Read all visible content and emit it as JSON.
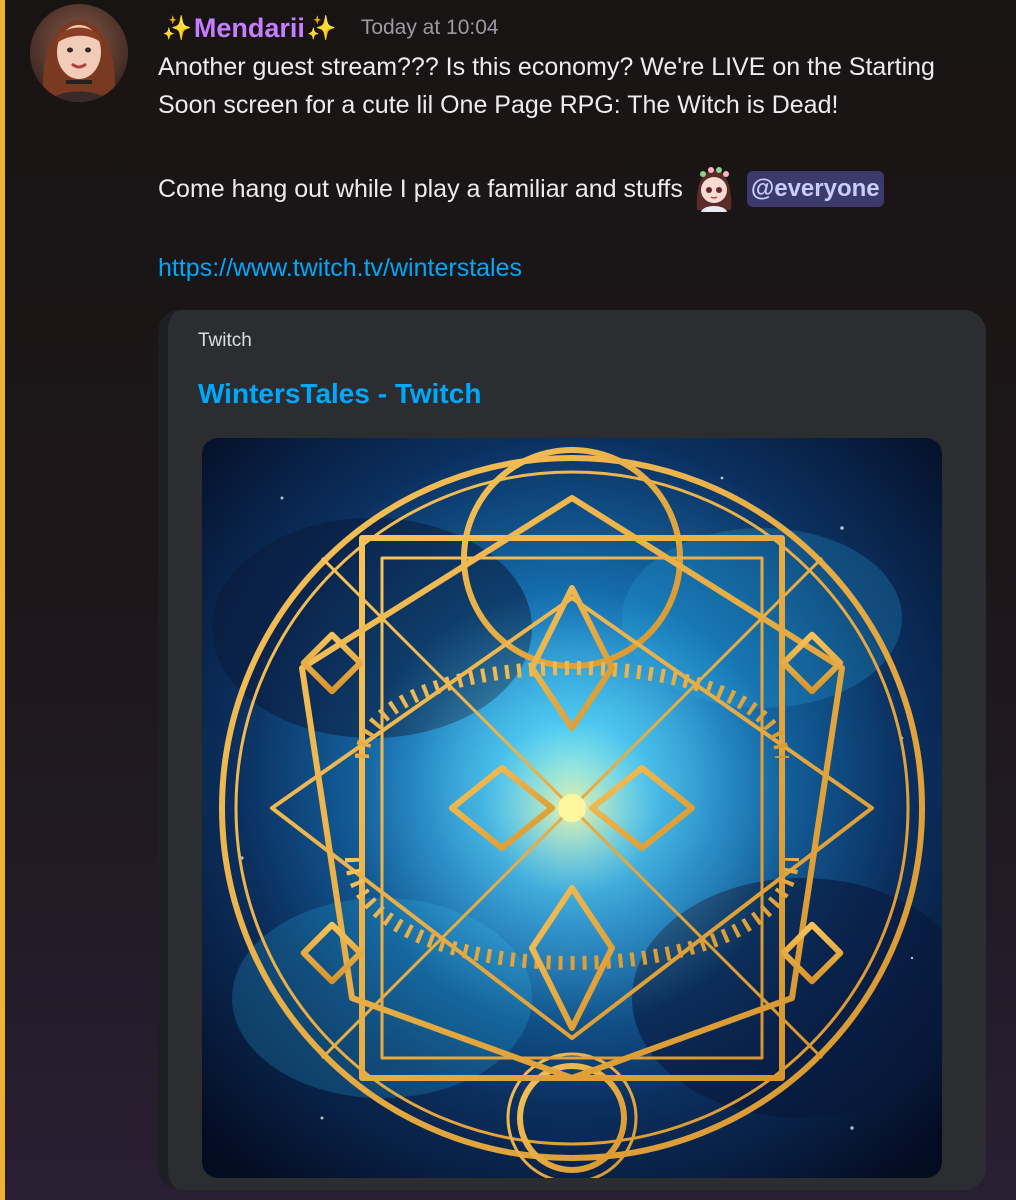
{
  "colors": {
    "mention_bar": "#f0b232",
    "username": "#c77dff",
    "link": "#00a8fc",
    "mention_bg": "#3c3a6b",
    "embed_bg": "#2b2d31"
  },
  "message": {
    "author": {
      "prefix_emoji": "✨",
      "name": "Mendarii",
      "suffix_emoji": "✨",
      "avatar_icon": "avatar-photo"
    },
    "timestamp": "Today at 10:04",
    "paragraph1": "Another guest stream??? Is this economy? We're LIVE on the Starting Soon screen for a cute lil One Page RPG: The Witch is Dead!",
    "line3_text": "Come hang out while I play a familiar and stuffs",
    "custom_emoji": "chibi-girl-emoji",
    "mention": "@everyone",
    "link": "https://www.twitch.tv/winterstales"
  },
  "embed": {
    "provider": "Twitch",
    "title": "WintersTales - Twitch",
    "image_icon": "magic-circle-image"
  }
}
